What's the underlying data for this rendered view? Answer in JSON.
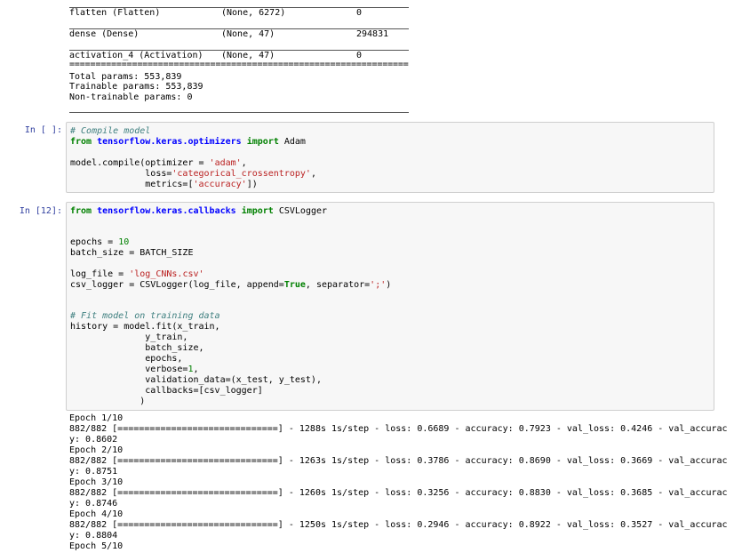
{
  "summary": {
    "rows": [
      {
        "layer": "flatten (Flatten)",
        "shape": "(None, 6272)",
        "params": "0"
      },
      {
        "layer": "dense (Dense)",
        "shape": "(None, 47)",
        "params": "294831"
      },
      {
        "layer": "activation_4 (Activation)",
        "shape": "(None, 47)",
        "params": "0"
      }
    ],
    "equals_line": "=================================================================",
    "total": "Total params: 553,839",
    "trainable": "Trainable params: 553,839",
    "non_trainable": "Non-trainable params: 0"
  },
  "cell_compile": {
    "prompt": "In [ ]:",
    "comment": "# Compile model",
    "import_from": "from",
    "import_module": "tensorflow.keras.optimizers",
    "import_kw": "import",
    "import_name": " Adam",
    "compile_prefix": "model.compile(optimizer = ",
    "optimizer_str": "'adam'",
    "compile_suffix1": ",",
    "loss_prefix": "              loss=",
    "loss_str": "'categorical_crossentropy'",
    "loss_suffix": ",",
    "metrics_prefix": "              metrics=[",
    "metrics_str": "'accuracy'",
    "metrics_suffix": "])"
  },
  "cell_fit": {
    "prompt": "In [12]:",
    "import_from": "from",
    "import_module": "tensorflow.keras.callbacks",
    "import_kw": "import",
    "import_name": " CSVLogger",
    "epochs_prefix": "epochs = ",
    "epochs_val": "10",
    "batch_line": "batch_size = BATCH_SIZE",
    "logfile_prefix": "log_file = ",
    "logfile_str": "'log_CNNs.csv'",
    "csv_prefix": "csv_logger = CSVLogger(log_file, append=",
    "csv_true": "True",
    "csv_mid": ", separator=",
    "csv_sep": "';'",
    "csv_suffix": ")",
    "fit_comment": "# Fit model on training data",
    "fit_line1": "history = model.fit(x_train,",
    "fit_line2": "              y_train,",
    "fit_line3": "              batch_size,",
    "fit_line4": "              epochs,",
    "fit_verbose_prefix": "              verbose=",
    "fit_verbose_val": "1",
    "fit_verbose_suffix": ",",
    "fit_line6": "              validation_data=(x_test, y_test),",
    "fit_line7": "              callbacks=[csv_logger]",
    "fit_line8": "             )"
  },
  "training_output": [
    "Epoch 1/10",
    "882/882 [==============================] - 1288s 1s/step - loss: 0.6689 - accuracy: 0.7923 - val_loss: 0.4246 - val_accurac",
    "y: 0.8602",
    "Epoch 2/10",
    "882/882 [==============================] - 1263s 1s/step - loss: 0.3786 - accuracy: 0.8690 - val_loss: 0.3669 - val_accurac",
    "y: 0.8751",
    "Epoch 3/10",
    "882/882 [==============================] - 1260s 1s/step - loss: 0.3256 - accuracy: 0.8830 - val_loss: 0.3685 - val_accurac",
    "y: 0.8746",
    "Epoch 4/10",
    "882/882 [==============================] - 1250s 1s/step - loss: 0.2946 - accuracy: 0.8922 - val_loss: 0.3527 - val_accurac",
    "y: 0.8804",
    "Epoch 5/10"
  ]
}
